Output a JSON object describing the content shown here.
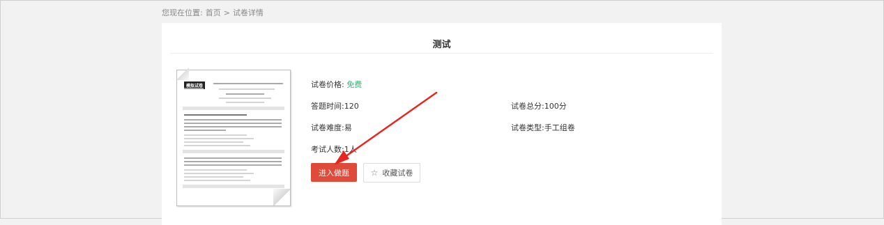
{
  "breadcrumb": {
    "prefix": "您现在位置:",
    "home": "首页",
    "separator": ">",
    "current": "试卷详情"
  },
  "page": {
    "title": "测试"
  },
  "thumbnail": {
    "logo_text": "模拟试卷"
  },
  "info": {
    "price_label": "试卷价格:",
    "price_value": "免费",
    "time_label": "答题时间:",
    "time_value": "120",
    "total_label": "试卷总分:",
    "total_value": "100分",
    "difficulty_label": "试卷难度:",
    "difficulty_value": "易",
    "type_label": "试卷类型:",
    "type_value": "手工组卷",
    "takers_label": "考试人数:",
    "takers_value": "1人"
  },
  "actions": {
    "start_label": "进入做题",
    "favorite_label": "收藏试卷"
  },
  "colors": {
    "primary": "#e04a3a",
    "free": "#2bb673",
    "annotation_arrow": "#e8261f"
  }
}
